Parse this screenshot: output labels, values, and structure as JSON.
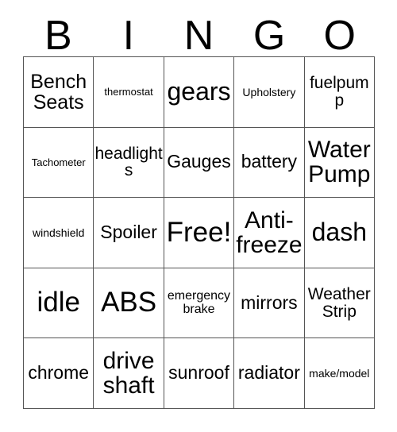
{
  "card": {
    "title": "BINGO",
    "header_letters": [
      "B",
      "I",
      "N",
      "G",
      "O"
    ],
    "free_space_label": "Free!",
    "grid_size": 5,
    "colors": {
      "background": "#ffffff",
      "text": "#000000",
      "grid_line": "#555555"
    },
    "columns": {
      "B": [
        "Bench Seats",
        "Tachometer",
        "windshield",
        "idle",
        "chrome"
      ],
      "I": [
        "thermostat",
        "headlights",
        "Spoiler",
        "ABS",
        "drive shaft"
      ],
      "N": [
        "gears",
        "Gauges",
        "Free!",
        "emergency brake",
        "sunroof"
      ],
      "G": [
        "Upholstery",
        "battery",
        "Anti-freeze",
        "mirrors",
        "radiator"
      ],
      "O": [
        "fuelpump",
        "Water Pump",
        "dash",
        "Weather Strip",
        "make/model"
      ]
    },
    "rows": [
      [
        {
          "text": "Bench Seats",
          "size": "fs-m"
        },
        {
          "text": "thermostat",
          "size": "fs-tiny"
        },
        {
          "text": "gears",
          "size": "fs-xl"
        },
        {
          "text": "Upholstery",
          "size": "fs-xxs"
        },
        {
          "text": "fuelpump",
          "size": "fs-s"
        }
      ],
      [
        {
          "text": "Tachometer",
          "size": "fs-tiny"
        },
        {
          "text": "headlights",
          "size": "fs-s"
        },
        {
          "text": "Gauges",
          "size": "fs-ms"
        },
        {
          "text": "battery",
          "size": "fs-ms"
        },
        {
          "text": "Water Pump",
          "size": "fs-l"
        }
      ],
      [
        {
          "text": "windshield",
          "size": "fs-xxs"
        },
        {
          "text": "Spoiler",
          "size": "fs-ms"
        },
        {
          "text": "Free!",
          "size": "fs-xxl"
        },
        {
          "text": "Anti-freeze",
          "size": "fs-l"
        },
        {
          "text": "dash",
          "size": "fs-xl"
        }
      ],
      [
        {
          "text": "idle",
          "size": "fs-xxl"
        },
        {
          "text": "ABS",
          "size": "fs-xxl"
        },
        {
          "text": "emergency brake",
          "size": "fs-xs"
        },
        {
          "text": "mirrors",
          "size": "fs-ms"
        },
        {
          "text": "Weather Strip",
          "size": "fs-s"
        }
      ],
      [
        {
          "text": "chrome",
          "size": "fs-ms"
        },
        {
          "text": "drive shaft",
          "size": "fs-l"
        },
        {
          "text": "sunroof",
          "size": "fs-ms"
        },
        {
          "text": "radiator",
          "size": "fs-ms"
        },
        {
          "text": "make/model",
          "size": "fs-xxs"
        }
      ]
    ]
  }
}
